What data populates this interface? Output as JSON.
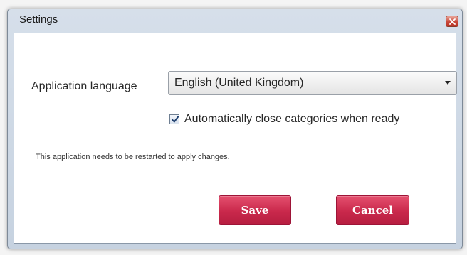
{
  "window": {
    "title": "Settings",
    "close_icon": "close-icon"
  },
  "form": {
    "language_label": "Application language",
    "language_select": {
      "selected": "English (United Kingdom)",
      "arrow_icon": "chevron-down-icon"
    },
    "auto_close": {
      "checked": true,
      "label": "Automatically close categories when ready"
    },
    "restart_note": "This application needs to be restarted to apply changes."
  },
  "actions": {
    "save_label": "Save",
    "cancel_label": "Cancel"
  },
  "colors": {
    "button_accent": "#c9284b",
    "titlebar": "#d0dae6",
    "close_button": "#c9483a"
  }
}
